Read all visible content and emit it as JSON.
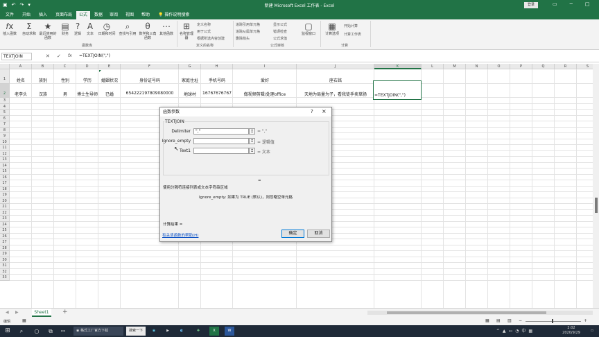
{
  "titlebar": {
    "title": "新建 Microsoft Excel 工作表 - Excel",
    "login": "登录"
  },
  "ribbon_tabs": [
    "文件",
    "开始",
    "插入",
    "页面布局",
    "公式",
    "数据",
    "审阅",
    "视图",
    "帮助",
    "操作说明搜索"
  ],
  "ribbon": {
    "buttons": [
      "插入函数",
      "自动求和",
      "最近使用的函数",
      "财务",
      "逻辑",
      "文本",
      "日期和时间",
      "查找与引用",
      "数学和三角函数",
      "其他函数",
      "名称管理器",
      "定义名称",
      "用于公式",
      "根据所选内容创建",
      "追踪引用单元格",
      "追踪从属单元格",
      "删除箭头",
      "显示公式",
      "错误检查",
      "公式求值",
      "监视窗口",
      "计算选项",
      "开始计算",
      "计算工作表"
    ],
    "groups": [
      "函数库",
      "定义的名称",
      "公式审核",
      "计算"
    ]
  },
  "formula_bar": {
    "name_box": "TEXTJOIN",
    "formula": "=TEXTJOIN(\",\")",
    "fx": "fx"
  },
  "sheet": {
    "columns": [
      "A",
      "B",
      "C",
      "D",
      "E",
      "F",
      "G",
      "H",
      "I",
      "J",
      "K",
      "L",
      "M",
      "N",
      "O",
      "P",
      "Q",
      "R",
      "S"
    ],
    "rows": [
      "1",
      "2",
      "3",
      "4",
      "5",
      "6",
      "7",
      "8",
      "9",
      "10",
      "11",
      "12",
      "13",
      "14",
      "15",
      "16",
      "17",
      "18",
      "19",
      "20",
      "21",
      "22",
      "23",
      "24",
      "25",
      "26",
      "27",
      "28",
      "29",
      "30",
      "31",
      "32",
      "33"
    ],
    "headers": [
      "姓名",
      "族别",
      "性别",
      "学历",
      "婚姻状况",
      "身份证号码",
      "家庭住址",
      "手机号码",
      "爱好",
      "座右铭"
    ],
    "row2": [
      "老李头",
      "汉族",
      "男",
      "博士生导师",
      "已婚",
      "654222197809080000",
      "地球村",
      "16767676767",
      "做视频剪辑/处理office",
      "天地为局量为子，看我徒手卖草肠"
    ],
    "editing": "=TEXTJOIN(\",\")"
  },
  "dialog": {
    "title": "函数参数",
    "help": "?",
    "close": "×",
    "func": "TEXTJOIN",
    "args": [
      {
        "label": "Delimiter",
        "value": "\",\"",
        "result": "= \",\""
      },
      {
        "label": "Ignore_empty",
        "value": "",
        "result": "= 逻辑值"
      },
      {
        "label": "Text1",
        "value": "",
        "result": "= 文本"
      }
    ],
    "equals": "=",
    "description": "使用分隔符连接列表或文本字符串区域",
    "arg_help": "Ignore_empty:  如果为 TRUE (默认)，则忽略空单元格",
    "calc_result": "计算结果 =",
    "help_link": "有关该函数的帮助(H)",
    "ok": "确定",
    "cancel": "取消"
  },
  "sheet_tabs": {
    "active": "Sheet1",
    "add": "+"
  },
  "status": {
    "mode": "编辑"
  },
  "taskbar": {
    "search": "搜索一下",
    "app": " 格式工厂官方下载",
    "time": "2:02",
    "date": "2020/9/29"
  }
}
